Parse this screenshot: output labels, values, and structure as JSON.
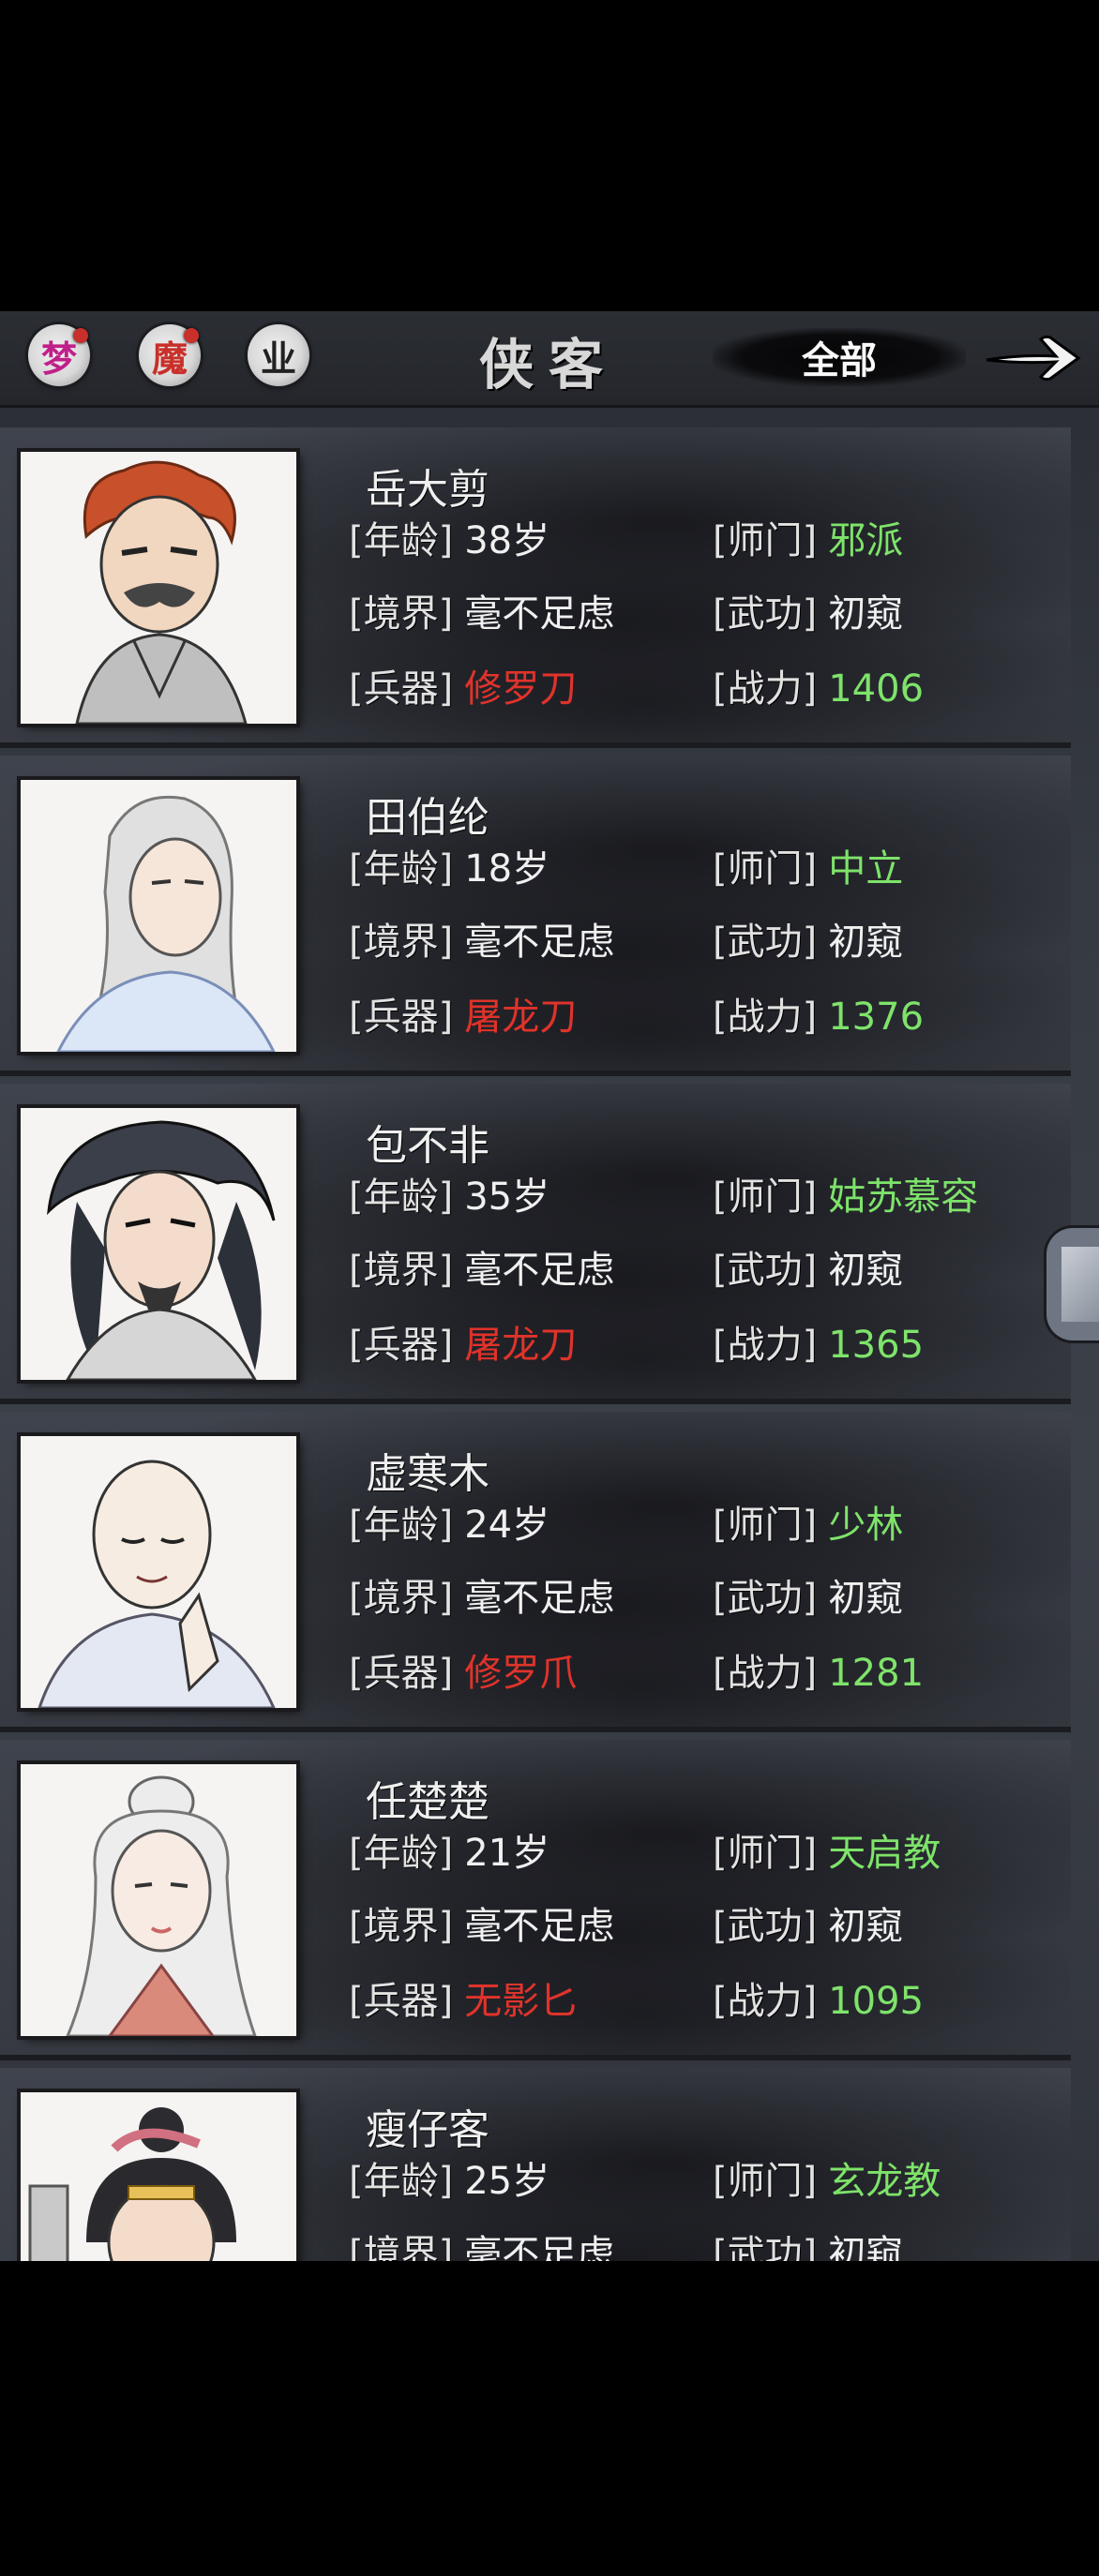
{
  "header": {
    "filters": [
      {
        "label": "梦",
        "color": "#c0208a",
        "has_notification": true
      },
      {
        "label": "魔",
        "color": "#c8302a",
        "has_notification": true
      },
      {
        "label": "业",
        "color": "#222222",
        "has_notification": false
      }
    ],
    "title": "侠客",
    "current_filter": "全部",
    "next_icon": "arrow-right-icon"
  },
  "field_labels": {
    "age": "[年龄]",
    "realm": "[境界]",
    "weapon": "[兵器]",
    "sect": "[师门]",
    "skill": "[武功]",
    "power": "[战力]"
  },
  "heroes": [
    {
      "name": "岳大剪",
      "age": "38岁",
      "realm": "毫不足虑",
      "weapon": "修罗刀",
      "sect": "邪派",
      "skill": "初窥",
      "power": "1406"
    },
    {
      "name": "田伯纶",
      "age": "18岁",
      "realm": "毫不足虑",
      "weapon": "屠龙刀",
      "sect": "中立",
      "skill": "初窥",
      "power": "1376"
    },
    {
      "name": "包不非",
      "age": "35岁",
      "realm": "毫不足虑",
      "weapon": "屠龙刀",
      "sect": "姑苏慕容",
      "skill": "初窥",
      "power": "1365"
    },
    {
      "name": "虚寒木",
      "age": "24岁",
      "realm": "毫不足虑",
      "weapon": "修罗爪",
      "sect": "少林",
      "skill": "初窥",
      "power": "1281"
    },
    {
      "name": "任楚楚",
      "age": "21岁",
      "realm": "毫不足虑",
      "weapon": "无影匕",
      "sect": "天启教",
      "skill": "初窥",
      "power": "1095"
    },
    {
      "name": "瘦仔客",
      "age": "25岁",
      "realm": "毫不足虑",
      "weapon": "",
      "sect": "玄龙教",
      "skill": "初窥",
      "power": ""
    }
  ]
}
